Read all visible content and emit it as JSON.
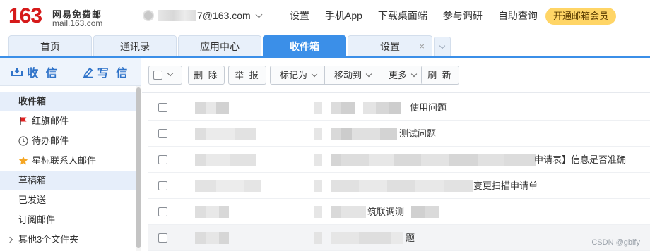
{
  "header": {
    "logo_number": "163",
    "logo_name": "网易免费邮",
    "logo_domain": "mail.163.com",
    "account_suffix": "7@163.com",
    "links": [
      "设置",
      "手机App",
      "下载桌面端",
      "参与调研",
      "自助查询"
    ],
    "vip_button": "开通邮箱会员"
  },
  "tabs": [
    {
      "label": "首页",
      "active": false
    },
    {
      "label": "通讯录",
      "active": false
    },
    {
      "label": "应用中心",
      "active": false
    },
    {
      "label": "收件箱",
      "active": true
    },
    {
      "label": "设置",
      "active": false,
      "closable": true,
      "close_symbol": "×"
    }
  ],
  "sidebar": {
    "receive_label": "收 信",
    "compose_label": "写 信",
    "folders": [
      {
        "label": "收件箱",
        "selected": true
      },
      {
        "label": "红旗邮件",
        "icon": "red-flag-icon"
      },
      {
        "label": "待办邮件",
        "icon": "clock-icon"
      },
      {
        "label": "星标联系人邮件",
        "icon": "star-icon"
      },
      {
        "label": "草稿箱"
      },
      {
        "label": "已发送"
      },
      {
        "label": "订阅邮件"
      },
      {
        "label": "其他3个文件夹",
        "expandable": true
      }
    ]
  },
  "toolbar": {
    "delete": "删 除",
    "report": "举 报",
    "mark_as": "标记为",
    "move_to": "移动到",
    "more": "更多",
    "refresh": "刷 新"
  },
  "messages": [
    {
      "subject_visible": "使用问题"
    },
    {
      "subject_visible": "测试问题"
    },
    {
      "subject_visible": "申请表】信息是否准确"
    },
    {
      "subject_visible": "变更扫描申请单"
    },
    {
      "subject_visible": "筑联调测"
    },
    {
      "subject_visible": "题"
    }
  ],
  "colors": {
    "accent": "#3b8fe8",
    "logo_red": "#d61a1a",
    "vip_yellow": "#ffd566",
    "flag_red": "#e02020",
    "star_orange": "#f5a623"
  },
  "watermark": "CSDN @gblfy"
}
